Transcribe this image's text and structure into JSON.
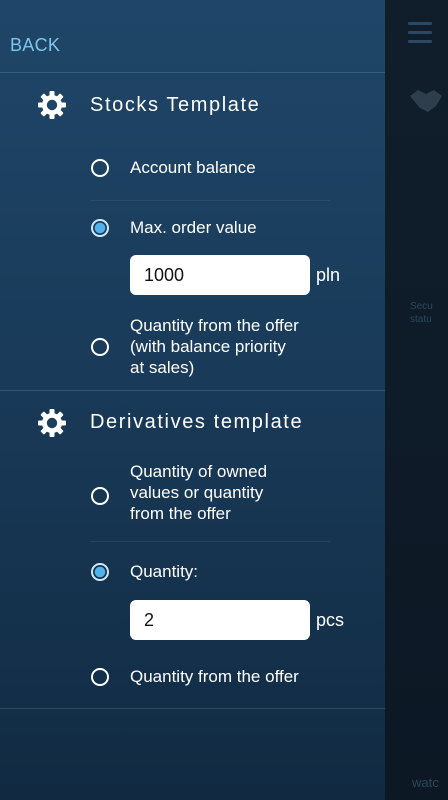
{
  "header": {
    "back_label": "BACK"
  },
  "stocks": {
    "title": "Stocks Template",
    "options": [
      {
        "label": "Account balance",
        "selected": false
      },
      {
        "label": "Max. order value",
        "selected": true
      },
      {
        "lines": [
          "Quantity from the offer",
          "(with balance priority",
          "at sales)"
        ],
        "selected": false
      }
    ],
    "input": {
      "value": "1000",
      "unit": "pln"
    }
  },
  "derivatives": {
    "title": "Derivatives template",
    "options": [
      {
        "lines": [
          "Quantity of owned",
          "values or quantity",
          "from the offer"
        ],
        "selected": false
      },
      {
        "label": "Quantity:",
        "selected": true
      },
      {
        "label": "Quantity from the offer",
        "selected": false
      }
    ],
    "input": {
      "value": "2",
      "unit": "pcs"
    }
  },
  "background": {
    "text_lines": [
      "Secu",
      "statu"
    ],
    "footer": "watc",
    "icons": [
      "menu-icon",
      "handshake-icon"
    ]
  },
  "colors": {
    "accent": "#4fb2ea",
    "back_link": "#7fc4ea",
    "panel": "#1a3c5b"
  }
}
